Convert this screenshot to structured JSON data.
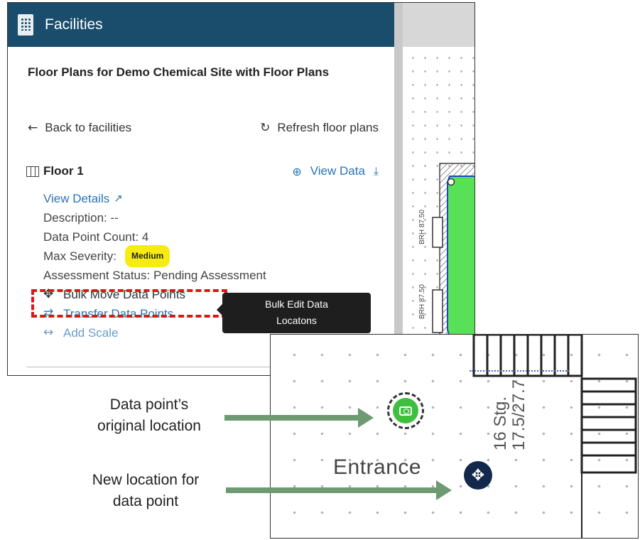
{
  "panel": {
    "header_title": "Facilities",
    "subtitle": "Floor Plans for Demo Chemical Site with Floor Plans",
    "back_label": "Back to facilities",
    "refresh_label": "Refresh floor plans"
  },
  "floor": {
    "name": "Floor 1",
    "view_data_label": "View Data",
    "view_details_label": "View Details",
    "description": "Description: --",
    "data_point_count": "Data Point Count: 4",
    "max_severity_label": "Max Severity:",
    "max_severity_value": "Medium",
    "assessment_status": "Assessment Status: Pending Assessment",
    "bulk_move_label": "Bulk Move Data Points",
    "transfer_label": "Transfer Data Points",
    "add_scale_label": "Add Scale"
  },
  "tooltip": {
    "line1": "Bulk Edit Data",
    "line2": "Locatons"
  },
  "zoom": {
    "entrance_label": "Entrance",
    "stg_line1": "16 Stg.",
    "stg_line2": "17.5/27.7"
  },
  "callouts": {
    "original_line1": "Data point’s",
    "original_line2": "original location",
    "new_line1": "New location for",
    "new_line2": "data point"
  },
  "colors": {
    "header_bg": "#1a4d6b",
    "link_blue": "#2a74b4",
    "severity_yellow": "#f6eb12",
    "highlight_red": "#e01515",
    "marker_green": "#3fbf3f",
    "marker_navy": "#13294b",
    "arrow_green": "#6e9a72"
  },
  "icons": {
    "header": "building-icon",
    "back": "arrow-left-icon",
    "refresh": "refresh-icon",
    "floor": "map-icon",
    "zoom": "search-plus-icon",
    "download": "download-icon",
    "external": "external-link-icon",
    "move": "arrows-move-icon",
    "transfer": "exchange-icon",
    "scale": "arrows-horizontal-icon",
    "camera": "camera-icon"
  }
}
